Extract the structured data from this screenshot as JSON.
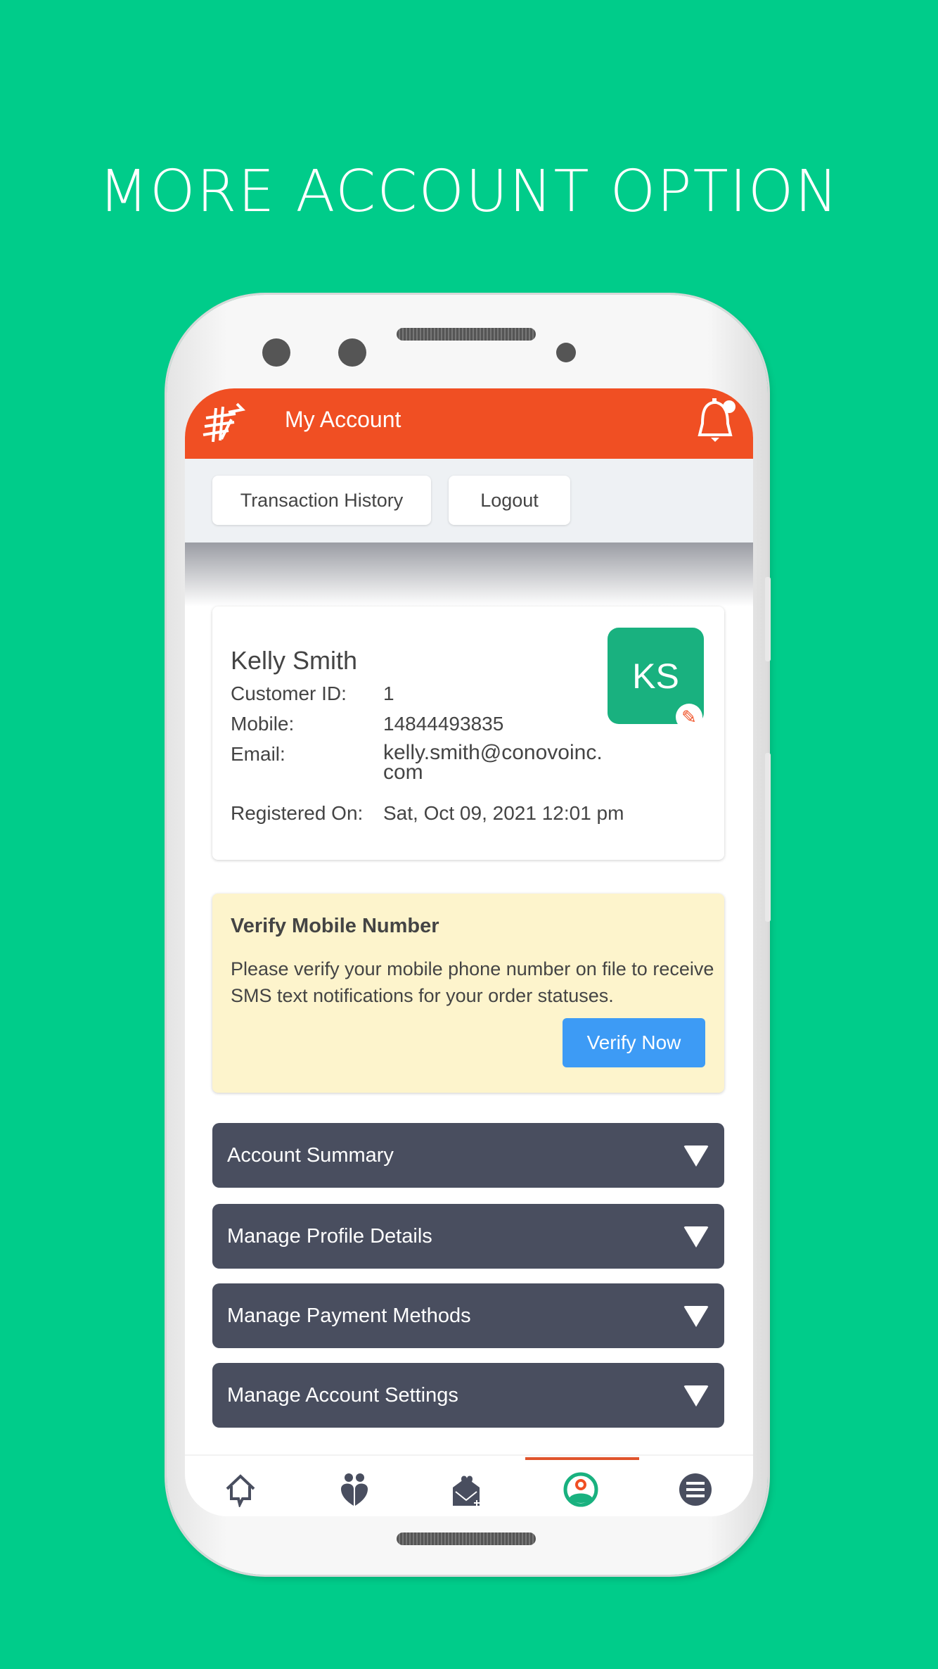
{
  "headline": "MORE ACCOUNT OPTION",
  "header": {
    "title": "My Account",
    "logo": "currency-exchange-logo",
    "notification_icon": "bell-icon"
  },
  "toolbar": {
    "transaction_history": "Transaction History",
    "logout": "Logout"
  },
  "profile": {
    "name": "Kelly Smith",
    "initials": "KS",
    "avatar_color": "#19b17f",
    "fields": [
      {
        "label": "Customer ID:",
        "value": "1"
      },
      {
        "label": "Mobile:",
        "value": "14844493835"
      },
      {
        "label": "Email:",
        "value": "kelly.smith@conovoinc.\ncom"
      },
      {
        "label": "Registered On:",
        "value": "Sat, Oct 09, 2021 12:01 pm"
      }
    ]
  },
  "verify": {
    "title": "Verify Mobile Number",
    "message": "Please verify your mobile phone number on file to receive SMS text notifications for your order statuses.",
    "button": "Verify Now"
  },
  "sections": [
    "Account Summary",
    "Manage Profile Details",
    "Manage Payment Methods",
    "Manage Account Settings"
  ],
  "bottom_nav": {
    "items": [
      "home-icon",
      "couple-icon",
      "love-letter-icon",
      "account-icon",
      "menu-icon"
    ],
    "active": "account-icon"
  },
  "colors": {
    "brand": "#f04f23",
    "accent": "#00cc8a",
    "button": "#3d9bf5",
    "section": "#494e5f"
  }
}
